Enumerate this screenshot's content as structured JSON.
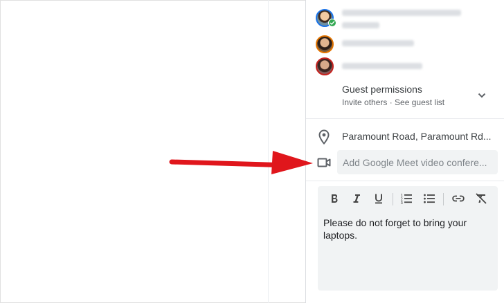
{
  "guests": {
    "permissions_title": "Guest permissions",
    "permissions_sub": "Invite others · See guest list"
  },
  "location": {
    "value": "Paramount Road, Paramount Rd..."
  },
  "meet": {
    "placeholder": "Add Google Meet video confere..."
  },
  "description": {
    "text": "Please do not forget to bring your laptops.",
    "toolbar": [
      "bold",
      "italic",
      "underline",
      "numbered-list",
      "bulleted-list",
      "link",
      "remove-formatting"
    ]
  },
  "colors": {
    "arrow": "#e0161c",
    "accent": "#1a73e8",
    "input_bg": "#f1f3f4"
  }
}
